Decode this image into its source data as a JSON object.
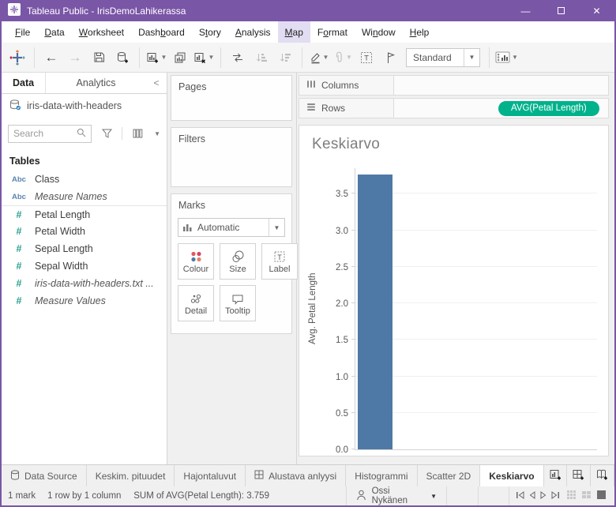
{
  "titlebar": {
    "title": "Tableau Public - IrisDemoLahikerassa"
  },
  "menu": {
    "items": [
      {
        "label": "File",
        "u": 0
      },
      {
        "label": "Data",
        "u": 0
      },
      {
        "label": "Worksheet",
        "u": 0
      },
      {
        "label": "Dashboard",
        "u": 4
      },
      {
        "label": "Story",
        "u": 1
      },
      {
        "label": "Analysis",
        "u": 0
      },
      {
        "label": "Map",
        "u": 0,
        "active": true
      },
      {
        "label": "Format",
        "u": 1
      },
      {
        "label": "Window",
        "u": 2
      },
      {
        "label": "Help",
        "u": 0
      }
    ]
  },
  "toolbar": {
    "view_mode": "Standard"
  },
  "datapane": {
    "tab_data": "Data",
    "tab_analytics": "Analytics",
    "collapse": "<",
    "datasource": "iris-data-with-headers",
    "search_placeholder": "Search",
    "tables_header": "Tables",
    "fields": [
      {
        "icon": "Abc",
        "name": "Class"
      },
      {
        "icon": "Abc",
        "name": "Measure Names",
        "italic": true
      },
      {
        "icon": "#",
        "name": "Petal Length",
        "divider": true
      },
      {
        "icon": "#",
        "name": "Petal Width"
      },
      {
        "icon": "#",
        "name": "Sepal Length"
      },
      {
        "icon": "#",
        "name": "Sepal Width"
      },
      {
        "icon": "#",
        "name": "iris-data-with-headers.txt ...",
        "italic": true
      },
      {
        "icon": "#",
        "name": "Measure Values",
        "italic": true
      }
    ]
  },
  "cards": {
    "pages": "Pages",
    "filters": "Filters",
    "marks": {
      "title": "Marks",
      "type": "Automatic",
      "buttons": [
        {
          "label": "Colour",
          "icon": "colour"
        },
        {
          "label": "Size",
          "icon": "size"
        },
        {
          "label": "Label",
          "icon": "label"
        },
        {
          "label": "Detail",
          "icon": "detail"
        },
        {
          "label": "Tooltip",
          "icon": "tooltip"
        }
      ]
    }
  },
  "shelves": {
    "columns_label": "Columns",
    "rows_label": "Rows",
    "rows_pills": [
      "AVG(Petal Length)"
    ]
  },
  "chart_data": {
    "type": "bar",
    "title": "Keskiarvo",
    "ylabel": "Avg. Petal Length",
    "categories": [
      ""
    ],
    "values": [
      3.759
    ],
    "ylim": [
      0,
      3.85
    ],
    "yticks": [
      0,
      0.5,
      1,
      1.5,
      2,
      2.5,
      3,
      3.5
    ],
    "bar_color": "#4e79a7",
    "grid": true,
    "legend": false
  },
  "sheet_tabs": {
    "tabs": [
      {
        "label": "Data Source",
        "icon": "database"
      },
      {
        "label": "Keskim. pituudet"
      },
      {
        "label": "Hajontaluvut"
      },
      {
        "label": "Alustava anlyysi",
        "icon": "dashboard"
      },
      {
        "label": "Histogrammi"
      },
      {
        "label": "Scatter 2D"
      },
      {
        "label": "Keskiarvo",
        "active": true
      }
    ],
    "new_buttons": [
      {
        "name": "new-worksheet"
      },
      {
        "name": "new-dashboard"
      },
      {
        "name": "new-story"
      }
    ]
  },
  "statusbar": {
    "marks": "1 mark",
    "dimensions": "1 row by 1 column",
    "aggregate": "SUM of AVG(Petal Length): 3.759",
    "user": "Ossi Nykänen"
  },
  "colors": {
    "titlebar": "#7a56a7",
    "pill_green": "#00b28c",
    "bar_blue": "#4e79a7",
    "menu_highlight": "#e2ddf2"
  }
}
